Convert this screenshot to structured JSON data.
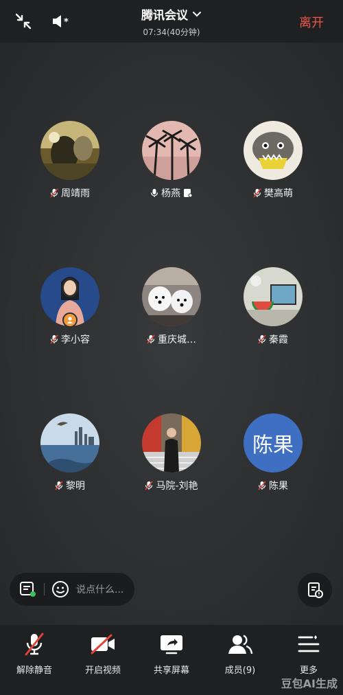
{
  "header": {
    "title": "腾讯会议",
    "subtitle": "07:34(40分钟)",
    "leave_label": "离开"
  },
  "members": [
    {
      "name": "周靖雨",
      "avatar": "landscape-photo"
    },
    {
      "name": "杨燕",
      "avatar": "palm-trees-photo"
    },
    {
      "name": "樊高萌",
      "avatar": "plush-toy-photo"
    },
    {
      "name": "李小容",
      "avatar": "person-photo"
    },
    {
      "name": "重庆城…",
      "avatar": "dogs-photo"
    },
    {
      "name": "秦霞",
      "avatar": "watermelon-photo"
    },
    {
      "name": "黎明",
      "avatar": "seaside-photo"
    },
    {
      "name": "马院-刘艳",
      "avatar": "street-photo"
    },
    {
      "name": "陈果",
      "avatar_text": "陈果"
    }
  ],
  "chat": {
    "placeholder": "说点什么..."
  },
  "toolbar": [
    {
      "label": "解除静音",
      "icon": "mic-muted-icon"
    },
    {
      "label": "开启视频",
      "icon": "video-off-icon"
    },
    {
      "label": "共享屏幕",
      "icon": "share-screen-icon"
    },
    {
      "label": "成员(9)",
      "icon": "members-icon"
    },
    {
      "label": "更多",
      "icon": "more-icon"
    }
  ],
  "watermark": "豆包AI生成",
  "colors": {
    "leave": "#f0574b",
    "muted_slash": "#e0443a",
    "avatar_text_bg": "#3f6fc2"
  }
}
